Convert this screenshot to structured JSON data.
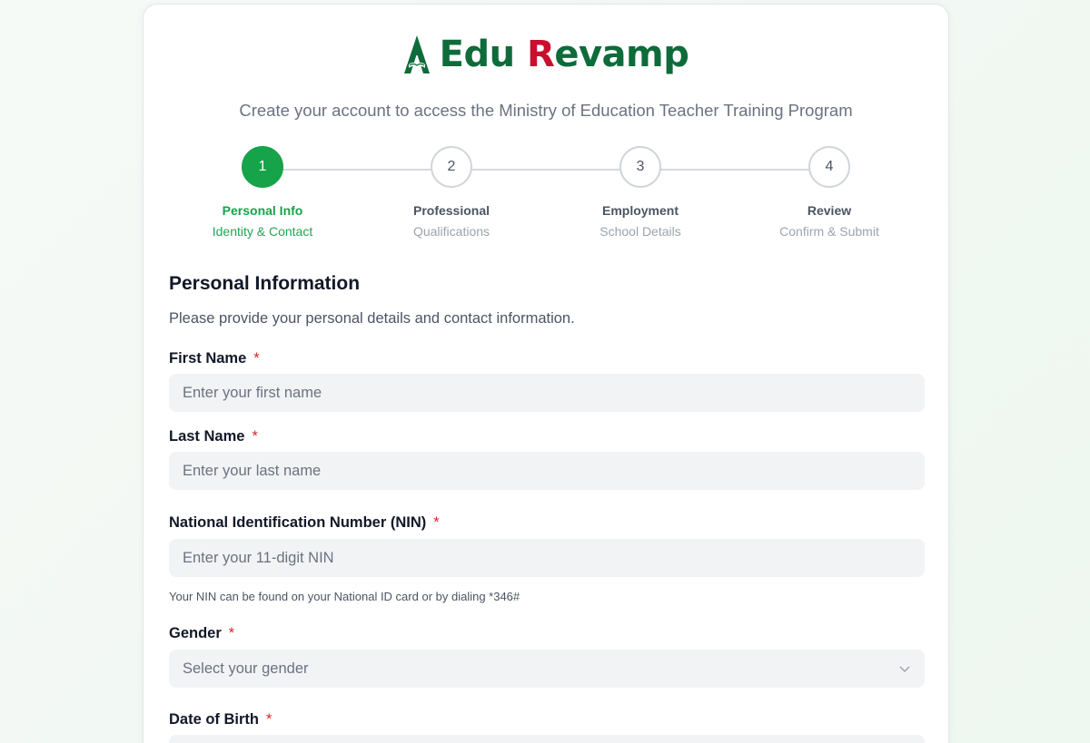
{
  "brand": {
    "name_part1": "Edu",
    "name_initial": "R",
    "name_rest": "evamp",
    "logo_icon": "open-book-tree-icon",
    "colors": {
      "green": "#0e6b3a",
      "red": "#c8102e"
    }
  },
  "subtitle": "Create your account to access the Ministry of Education Teacher Training Program",
  "stepper": {
    "active_color": "#17a34a",
    "steps": [
      {
        "number": "1",
        "title": "Personal Info",
        "subtitle": "Identity & Contact",
        "active": true
      },
      {
        "number": "2",
        "title": "Professional",
        "subtitle": "Qualifications",
        "active": false
      },
      {
        "number": "3",
        "title": "Employment",
        "subtitle": "School Details",
        "active": false
      },
      {
        "number": "4",
        "title": "Review",
        "subtitle": "Confirm & Submit",
        "active": false
      }
    ]
  },
  "section": {
    "title": "Personal Information",
    "description": "Please provide your personal details and contact information."
  },
  "form": {
    "required_marker": "*",
    "first_name": {
      "label": "First Name",
      "placeholder": "Enter your first name",
      "value": ""
    },
    "last_name": {
      "label": "Last Name",
      "placeholder": "Enter your last name",
      "value": ""
    },
    "nin": {
      "label": "National Identification Number (NIN)",
      "placeholder": "Enter your 11-digit NIN",
      "value": "",
      "help": "Your NIN can be found on your National ID card or by dialing *346#"
    },
    "gender": {
      "label": "Gender",
      "placeholder": "Select your gender",
      "icon": "chevron-down-icon"
    },
    "dob": {
      "label": "Date of Birth"
    }
  }
}
